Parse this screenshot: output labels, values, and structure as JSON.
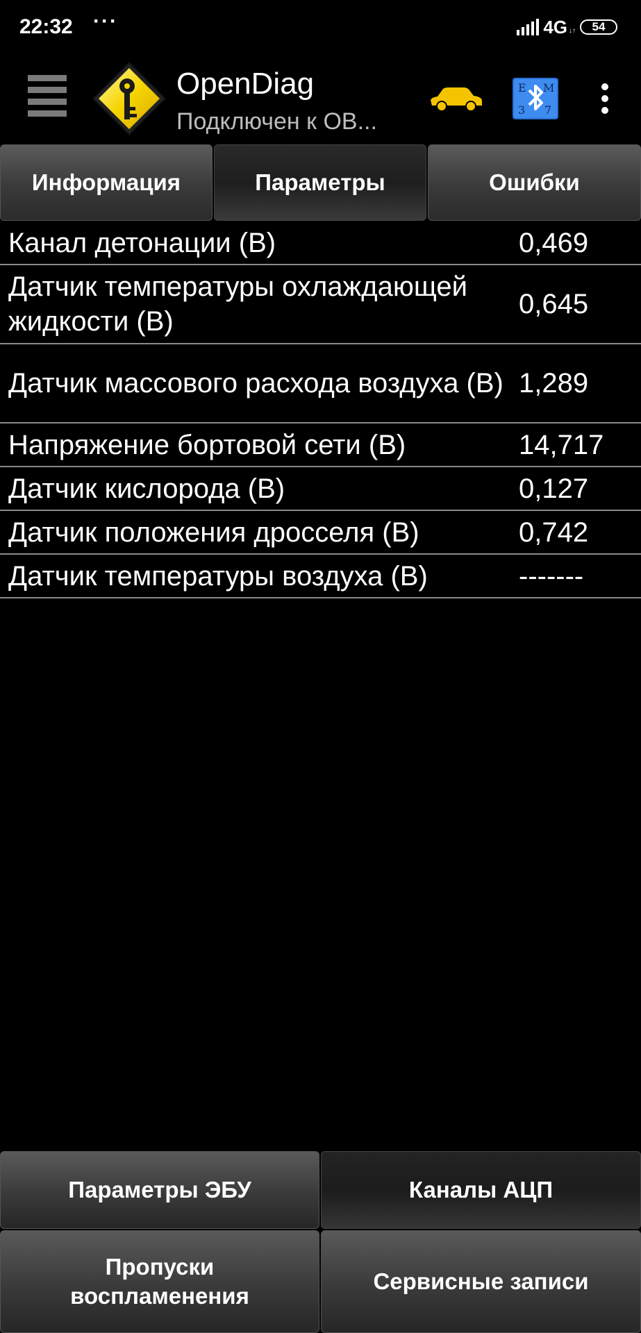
{
  "status_bar": {
    "time": "22:32",
    "dots": "···",
    "network": "4G",
    "battery": "54"
  },
  "app_bar": {
    "title": "OpenDiag",
    "subtitle": "Подключен к OB...",
    "icons": [
      "menu-icon",
      "app-logo-key-icon",
      "car-icon",
      "bluetooth-ebm-icon",
      "more-vert-icon"
    ],
    "car_color": "#f5c400"
  },
  "tabs": [
    {
      "label": "Информация",
      "selected": false
    },
    {
      "label": "Параметры",
      "selected": true
    },
    {
      "label": "Ошибки",
      "selected": false
    }
  ],
  "parameters": [
    {
      "name": "Канал детонации (В)",
      "value": "0,469"
    },
    {
      "name": "Датчик температуры охлаждающей жидкости (В)",
      "value": "0,645"
    },
    {
      "name": "Датчик массового расхода воздуха (В)",
      "value": "1,289"
    },
    {
      "name": "Напряжение бортовой сети (В)",
      "value": "14,717"
    },
    {
      "name": "Датчик кислорода (В)",
      "value": "0,127"
    },
    {
      "name": "Датчик положения дросселя (В)",
      "value": "0,742"
    },
    {
      "name": "Датчик температуры воздуха (В)",
      "value": "-------"
    }
  ],
  "bottom_buttons": {
    "ecu_params": "Параметры ЭБУ",
    "adc_channels": "Каналы АЦП",
    "misfires": "Пропуски воспламенения",
    "service_records": "Сервисные записи"
  }
}
